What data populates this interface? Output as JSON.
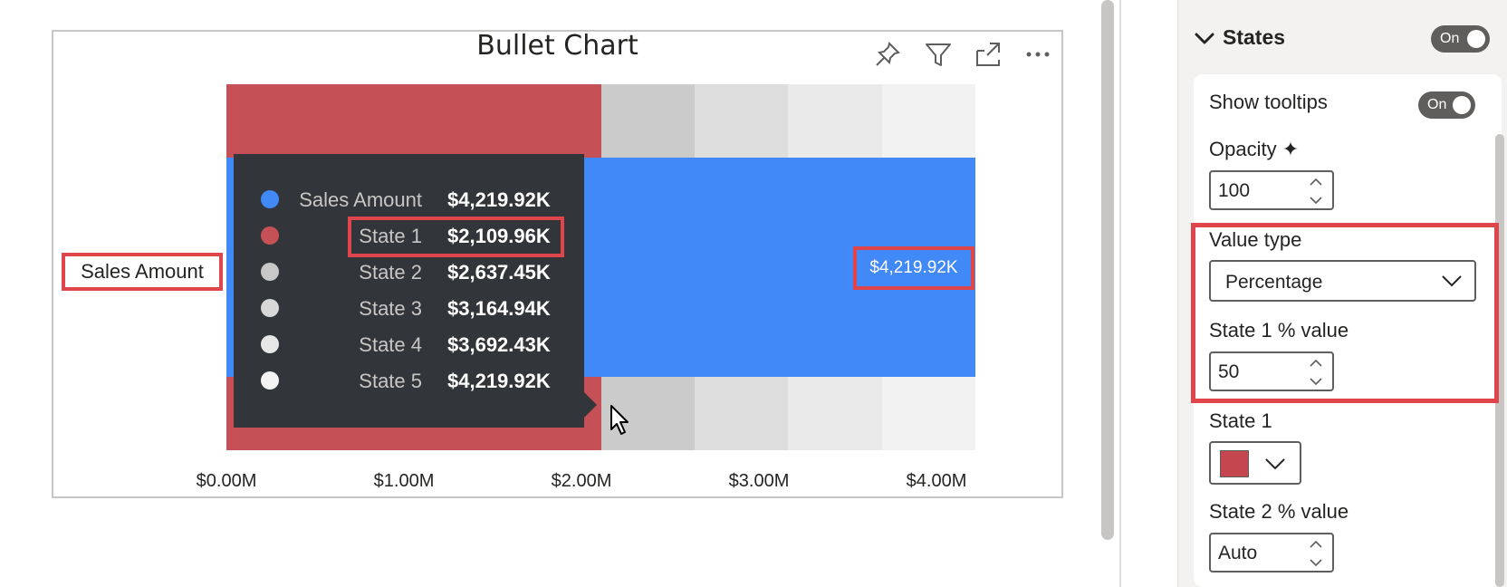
{
  "chart": {
    "title": "Bullet Chart",
    "category_label": "Sales Amount",
    "data_label": "$4,219.92K",
    "x_ticks": [
      "$0.00M",
      "$1.00M",
      "$2.00M",
      "$3.00M",
      "$4.00M"
    ],
    "header_icons": [
      "pin-icon",
      "filter-icon",
      "focus-mode-icon",
      "more-options-icon"
    ]
  },
  "chart_data": {
    "type": "bar",
    "categories": [
      "Sales Amount"
    ],
    "series": [
      {
        "name": "Sales Amount",
        "values": [
          4219.92
        ]
      }
    ],
    "states": [
      {
        "name": "State 1",
        "value": 2109.96,
        "color": "#c55055"
      },
      {
        "name": "State 2",
        "value": 2637.45,
        "color": "#cbcbcb"
      },
      {
        "name": "State 3",
        "value": 3164.94,
        "color": "#dedede"
      },
      {
        "name": "State 4",
        "value": 3692.43,
        "color": "#eaeaea"
      },
      {
        "name": "State 5",
        "value": 4219.92,
        "color": "#f2f2f2"
      }
    ],
    "unit": "K",
    "bar_color": "#4189f7",
    "xlabel": "",
    "ylabel": "",
    "xlim": [
      0,
      4.22
    ],
    "x_axis_unit": "M",
    "grid": false
  },
  "tooltip": {
    "rows": [
      {
        "name": "Sales Amount",
        "value": "$4,219.92K",
        "color": "#4189f7"
      },
      {
        "name": "State 1",
        "value": "$2,109.96K",
        "color": "#c55055"
      },
      {
        "name": "State 2",
        "value": "$2,637.45K",
        "color": "#c8c8c8"
      },
      {
        "name": "State 3",
        "value": "$3,164.94K",
        "color": "#d8d8d8"
      },
      {
        "name": "State 4",
        "value": "$3,692.43K",
        "color": "#e6e6e6"
      },
      {
        "name": "State 5",
        "value": "$4,219.92K",
        "color": "#f4f4f4"
      }
    ]
  },
  "pane": {
    "section_title": "States",
    "section_toggle": "On",
    "show_tooltips_label": "Show tooltips",
    "show_tooltips_toggle": "On",
    "opacity_label": "Opacity",
    "opacity_value": "100",
    "value_type_label": "Value type",
    "value_type_value": "Percentage",
    "state1_pct_label": "State 1 % value",
    "state1_pct_value": "50",
    "state1_label": "State 1",
    "state1_color": "#c4464e",
    "state2_pct_label": "State 2 % value",
    "state2_pct_value": "Auto"
  },
  "colors": {
    "highlight": "#e0454c",
    "accent_bar": "#4189f7"
  }
}
